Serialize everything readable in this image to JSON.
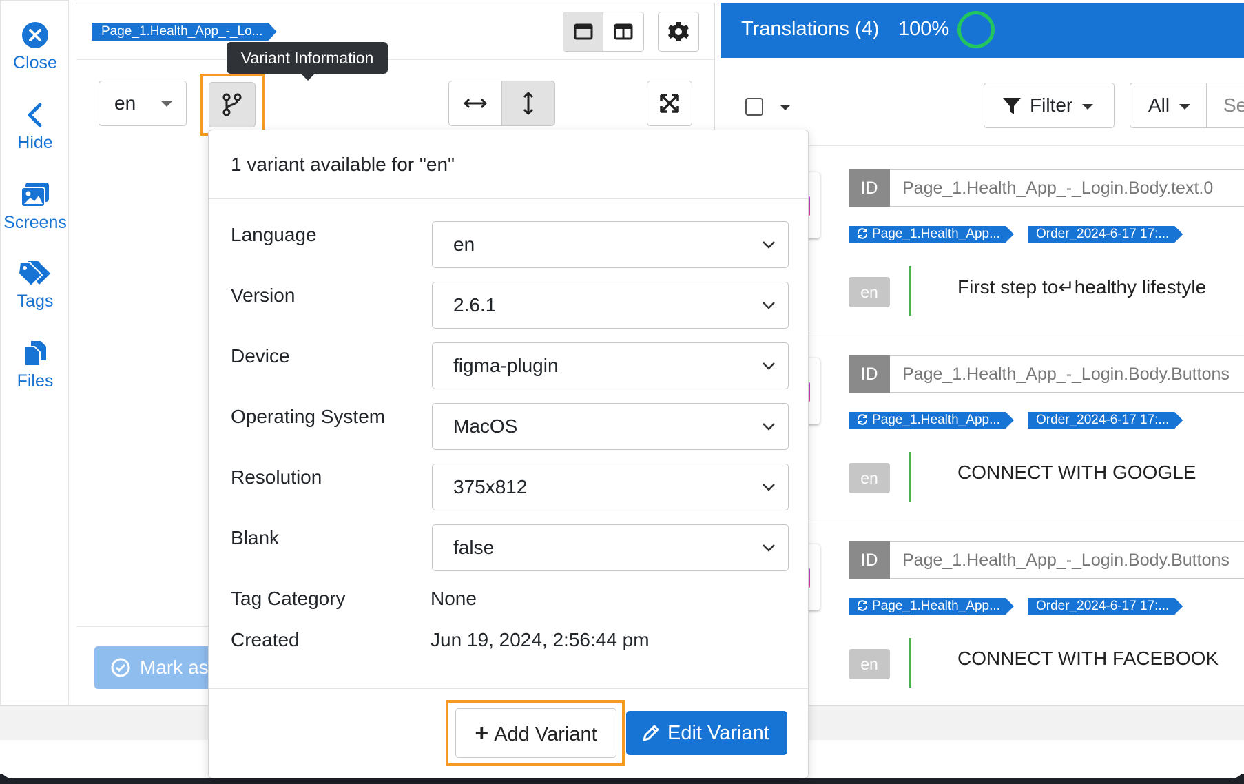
{
  "nav": {
    "items": [
      {
        "label": "Close"
      },
      {
        "label": "Hide"
      },
      {
        "label": "Screens"
      },
      {
        "label": "Tags"
      },
      {
        "label": "Files"
      }
    ]
  },
  "preview": {
    "breadcrumb": "Page_1.Health_App_-_Lo...",
    "tooltip": "Variant Information",
    "language_select": "en",
    "mark_button": "Mark as"
  },
  "popover": {
    "header": "1 variant available for \"en\"",
    "fields": [
      {
        "label": "Language",
        "value": "en"
      },
      {
        "label": "Version",
        "value": "2.6.1"
      },
      {
        "label": "Device",
        "value": "figma-plugin"
      },
      {
        "label": "Operating System",
        "value": "MacOS"
      },
      {
        "label": "Resolution",
        "value": "375x812"
      },
      {
        "label": "Blank",
        "value": "false"
      }
    ],
    "static_fields": [
      {
        "label": "Tag Category",
        "value": "None"
      },
      {
        "label": "Created",
        "value": "Jun 19, 2024, 2:56:44 pm"
      }
    ],
    "add_variant": "Add Variant",
    "edit_variant": "Edit Variant"
  },
  "translations": {
    "title": "Translations (4)",
    "percent": "100%",
    "filter_label": "Filter",
    "all_label": "All",
    "search_stub": "Se",
    "rows": [
      {
        "id_label": "ID",
        "id": "Page_1.Health_App_-_Login.Body.text.0",
        "chip1": "Page_1.Health_App...",
        "chip2": "Order_2024-6-17 17:...",
        "lang": "en",
        "text": "First step to↵healthy lifestyle"
      },
      {
        "id_label": "ID",
        "id": "Page_1.Health_App_-_Login.Body.Buttons",
        "chip1": "Page_1.Health_App...",
        "chip2": "Order_2024-6-17 17:...",
        "lang": "en",
        "text": "CONNECT WITH GOOGLE"
      },
      {
        "id_label": "ID",
        "id": "Page_1.Health_App_-_Login.Body.Buttons",
        "chip1": "Page_1.Health_App...",
        "chip2": "Order_2024-6-17 17:...",
        "lang": "en",
        "text": "CONNECT WITH FACEBOOK"
      }
    ]
  },
  "colors": {
    "primary": "#1774d4",
    "highlight": "#f59a23",
    "progress": "#22c55e"
  }
}
